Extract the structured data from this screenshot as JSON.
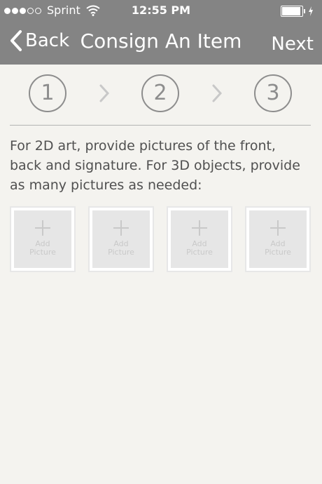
{
  "status_bar": {
    "carrier": "Sprint",
    "time": "12:55 PM",
    "signal_bars": 3,
    "signal_total": 5
  },
  "nav": {
    "back_label": "Back",
    "title": "Consign An Item",
    "next_label": "Next"
  },
  "steps": [
    "1",
    "2",
    "3"
  ],
  "instructions": "For 2D art, provide pictures of the front, back and signature.  For 3D objects, provide as many pictures as needed:",
  "picture_slots": [
    {
      "line1": "Add",
      "line2": "Picture"
    },
    {
      "line1": "Add",
      "line2": "Picture"
    },
    {
      "line1": "Add",
      "line2": "Picture"
    },
    {
      "line1": "Add",
      "line2": "Picture"
    }
  ],
  "colors": {
    "navbar": "#848484",
    "background": "#f4f3ef",
    "step_outline": "#8d8d8d"
  }
}
